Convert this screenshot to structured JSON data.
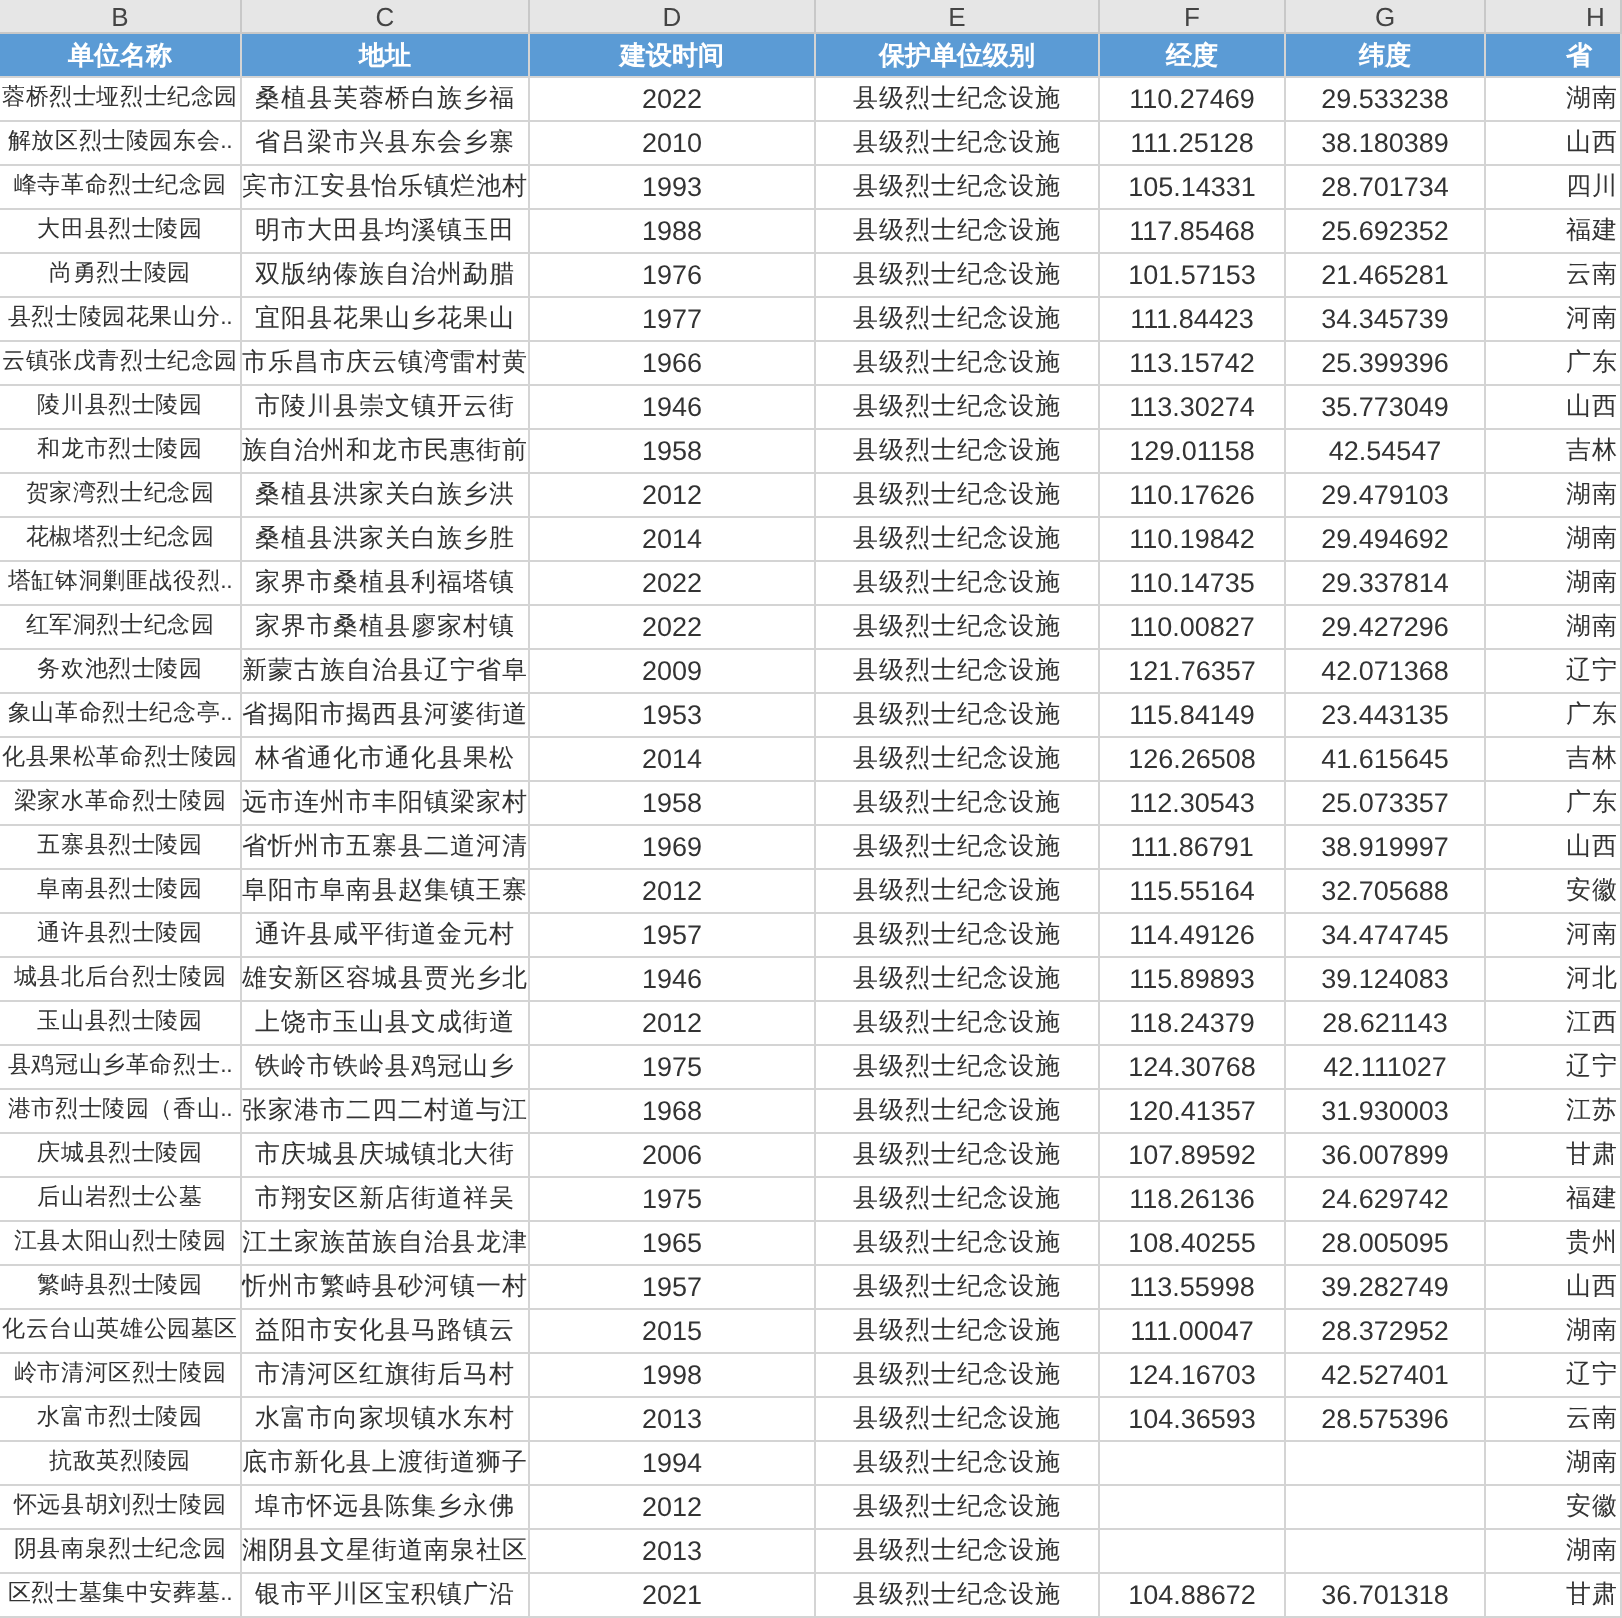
{
  "column_letters": [
    "B",
    "C",
    "D",
    "E",
    "F",
    "G",
    "H"
  ],
  "columns": [
    "单位名称",
    "地址",
    "建设时间",
    "保护单位级别",
    "经度",
    "纬度",
    "省"
  ],
  "rows": [
    {
      "name": "蓉桥烈士垭烈士纪念园",
      "address": "桑植县芙蓉桥白族乡福",
      "built": "2022",
      "level": "县级烈士纪念设施",
      "longitude": "110.27469",
      "latitude": "29.533238",
      "province": "湖南"
    },
    {
      "name": "解放区烈士陵园东会..",
      "address": "省吕梁市兴县东会乡寨",
      "built": "2010",
      "level": "县级烈士纪念设施",
      "longitude": "111.25128",
      "latitude": "38.180389",
      "province": "山西"
    },
    {
      "name": "峰寺革命烈士纪念园",
      "address": "宾市江安县怡乐镇烂池村",
      "built": "1993",
      "level": "县级烈士纪念设施",
      "longitude": "105.14331",
      "latitude": "28.701734",
      "province": "四川"
    },
    {
      "name": "大田县烈士陵园",
      "address": "明市大田县均溪镇玉田",
      "built": "1988",
      "level": "县级烈士纪念设施",
      "longitude": "117.85468",
      "latitude": "25.692352",
      "province": "福建"
    },
    {
      "name": "尚勇烈士陵园",
      "address": "双版纳傣族自治州勐腊",
      "built": "1976",
      "level": "县级烈士纪念设施",
      "longitude": "101.57153",
      "latitude": "21.465281",
      "province": "云南"
    },
    {
      "name": "县烈士陵园花果山分..",
      "address": "宜阳县花果山乡花果山",
      "built": "1977",
      "level": "县级烈士纪念设施",
      "longitude": "111.84423",
      "latitude": "34.345739",
      "province": "河南"
    },
    {
      "name": "云镇张戊青烈士纪念园",
      "address": "市乐昌市庆云镇湾雷村黄",
      "built": "1966",
      "level": "县级烈士纪念设施",
      "longitude": "113.15742",
      "latitude": "25.399396",
      "province": "广东"
    },
    {
      "name": "陵川县烈士陵园",
      "address": "市陵川县崇文镇开云街",
      "built": "1946",
      "level": "县级烈士纪念设施",
      "longitude": "113.30274",
      "latitude": "35.773049",
      "province": "山西"
    },
    {
      "name": "和龙市烈士陵园",
      "address": "族自治州和龙市民惠街前",
      "built": "1958",
      "level": "县级烈士纪念设施",
      "longitude": "129.01158",
      "latitude": "42.54547",
      "province": "吉林"
    },
    {
      "name": "贺家湾烈士纪念园",
      "address": "桑植县洪家关白族乡洪",
      "built": "2012",
      "level": "县级烈士纪念设施",
      "longitude": "110.17626",
      "latitude": "29.479103",
      "province": "湖南"
    },
    {
      "name": "花椒塔烈士纪念园",
      "address": "桑植县洪家关白族乡胜",
      "built": "2014",
      "level": "县级烈士纪念设施",
      "longitude": "110.19842",
      "latitude": "29.494692",
      "province": "湖南"
    },
    {
      "name": "塔缸钵洞剿匪战役烈..",
      "address": "家界市桑植县利福塔镇",
      "built": "2022",
      "level": "县级烈士纪念设施",
      "longitude": "110.14735",
      "latitude": "29.337814",
      "province": "湖南"
    },
    {
      "name": "红军洞烈士纪念园",
      "address": "家界市桑植县廖家村镇",
      "built": "2022",
      "level": "县级烈士纪念设施",
      "longitude": "110.00827",
      "latitude": "29.427296",
      "province": "湖南"
    },
    {
      "name": "务欢池烈士陵园",
      "address": "新蒙古族自治县辽宁省阜",
      "built": "2009",
      "level": "县级烈士纪念设施",
      "longitude": "121.76357",
      "latitude": "42.071368",
      "province": "辽宁"
    },
    {
      "name": "象山革命烈士纪念亭..",
      "address": "省揭阳市揭西县河婆街道",
      "built": "1953",
      "level": "县级烈士纪念设施",
      "longitude": "115.84149",
      "latitude": "23.443135",
      "province": "广东"
    },
    {
      "name": "化县果松革命烈士陵园",
      "address": "林省通化市通化县果松",
      "built": "2014",
      "level": "县级烈士纪念设施",
      "longitude": "126.26508",
      "latitude": "41.615645",
      "province": "吉林"
    },
    {
      "name": "梁家水革命烈士陵园",
      "address": "远市连州市丰阳镇梁家村",
      "built": "1958",
      "level": "县级烈士纪念设施",
      "longitude": "112.30543",
      "latitude": "25.073357",
      "province": "广东"
    },
    {
      "name": "五寨县烈士陵园",
      "address": "省忻州市五寨县二道河清",
      "built": "1969",
      "level": "县级烈士纪念设施",
      "longitude": "111.86791",
      "latitude": "38.919997",
      "province": "山西"
    },
    {
      "name": "阜南县烈士陵园",
      "address": "阜阳市阜南县赵集镇王寨",
      "built": "2012",
      "level": "县级烈士纪念设施",
      "longitude": "115.55164",
      "latitude": "32.705688",
      "province": "安徽"
    },
    {
      "name": "通许县烈士陵园",
      "address": "通许县咸平街道金元村",
      "built": "1957",
      "level": "县级烈士纪念设施",
      "longitude": "114.49126",
      "latitude": "34.474745",
      "province": "河南"
    },
    {
      "name": "城县北后台烈士陵园",
      "address": "雄安新区容城县贾光乡北",
      "built": "1946",
      "level": "县级烈士纪念设施",
      "longitude": "115.89893",
      "latitude": "39.124083",
      "province": "河北"
    },
    {
      "name": "玉山县烈士陵园",
      "address": "上饶市玉山县文成街道",
      "built": "2012",
      "level": "县级烈士纪念设施",
      "longitude": "118.24379",
      "latitude": "28.621143",
      "province": "江西"
    },
    {
      "name": "县鸡冠山乡革命烈士..",
      "address": "铁岭市铁岭县鸡冠山乡",
      "built": "1975",
      "level": "县级烈士纪念设施",
      "longitude": "124.30768",
      "latitude": "42.111027",
      "province": "辽宁"
    },
    {
      "name": "港市烈士陵园（香山..",
      "address": "张家港市二四二村道与江",
      "built": "1968",
      "level": "县级烈士纪念设施",
      "longitude": "120.41357",
      "latitude": "31.930003",
      "province": "江苏"
    },
    {
      "name": "庆城县烈士陵园",
      "address": "市庆城县庆城镇北大街",
      "built": "2006",
      "level": "县级烈士纪念设施",
      "longitude": "107.89592",
      "latitude": "36.007899",
      "province": "甘肃"
    },
    {
      "name": "后山岩烈士公墓",
      "address": "市翔安区新店街道祥吴",
      "built": "1975",
      "level": "县级烈士纪念设施",
      "longitude": "118.26136",
      "latitude": "24.629742",
      "province": "福建"
    },
    {
      "name": "江县太阳山烈士陵园",
      "address": "江土家族苗族自治县龙津",
      "built": "1965",
      "level": "县级烈士纪念设施",
      "longitude": "108.40255",
      "latitude": "28.005095",
      "province": "贵州"
    },
    {
      "name": "繁峙县烈士陵园",
      "address": "忻州市繁峙县砂河镇一村",
      "built": "1957",
      "level": "县级烈士纪念设施",
      "longitude": "113.55998",
      "latitude": "39.282749",
      "province": "山西"
    },
    {
      "name": "化云台山英雄公园墓区",
      "address": "益阳市安化县马路镇云",
      "built": "2015",
      "level": "县级烈士纪念设施",
      "longitude": "111.00047",
      "latitude": "28.372952",
      "province": "湖南"
    },
    {
      "name": "岭市清河区烈士陵园",
      "address": "市清河区红旗街后马村",
      "built": "1998",
      "level": "县级烈士纪念设施",
      "longitude": "124.16703",
      "latitude": "42.527401",
      "province": "辽宁"
    },
    {
      "name": "水富市烈士陵园",
      "address": "水富市向家坝镇水东村",
      "built": "2013",
      "level": "县级烈士纪念设施",
      "longitude": "104.36593",
      "latitude": "28.575396",
      "province": "云南"
    },
    {
      "name": "抗敌英烈陵园",
      "address": "底市新化县上渡街道狮子",
      "built": "1994",
      "level": "县级烈士纪念设施",
      "province": "湖南"
    },
    {
      "name": "怀远县胡刘烈士陵园",
      "address": "埠市怀远县陈集乡永佛",
      "built": "2012",
      "level": "县级烈士纪念设施",
      "province": "安徽"
    },
    {
      "name": "阴县南泉烈士纪念园",
      "address": "湘阴县文星街道南泉社区",
      "built": "2013",
      "level": "县级烈士纪念设施",
      "province": "湖南"
    },
    {
      "name": "区烈士墓集中安葬墓..",
      "address": "银市平川区宝积镇广沿",
      "built": "2021",
      "level": "县级烈士纪念设施",
      "longitude": "104.88672",
      "latitude": "36.701318",
      "province": "甘肃"
    }
  ]
}
